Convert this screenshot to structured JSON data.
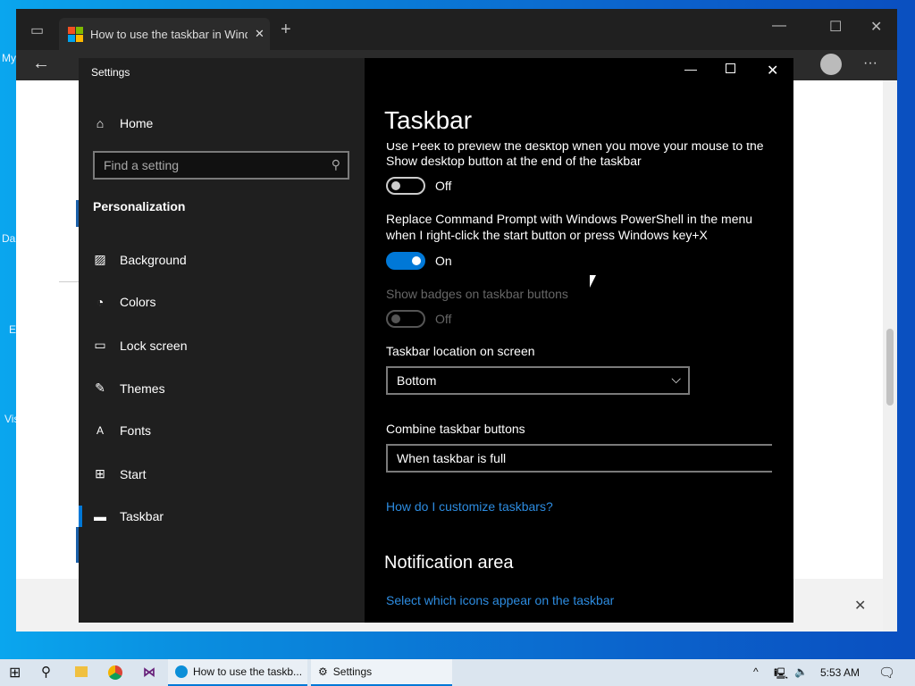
{
  "desktop": {
    "icons": [
      "My",
      "Da",
      "E",
      "Vis"
    ]
  },
  "browser": {
    "tab_title": "How to use the taskbar in Windo",
    "new_tab": "+",
    "more": "···"
  },
  "settings": {
    "window_title": "Settings",
    "nav": {
      "home": "Home",
      "search_placeholder": "Find a setting",
      "section": "Personalization",
      "items": [
        {
          "label": "Background",
          "icon": "picture-icon"
        },
        {
          "label": "Colors",
          "icon": "palette-icon"
        },
        {
          "label": "Lock screen",
          "icon": "lock-screen-icon"
        },
        {
          "label": "Themes",
          "icon": "themes-icon"
        },
        {
          "label": "Fonts",
          "icon": "fonts-icon"
        },
        {
          "label": "Start",
          "icon": "start-icon"
        },
        {
          "label": "Taskbar",
          "icon": "taskbar-icon",
          "selected": true
        }
      ]
    },
    "page_title": "Taskbar",
    "peek": {
      "text1": "Use Peek to preview the desktop when you move your mouse to the",
      "text2": "Show desktop button at the end of the taskbar",
      "state": "Off"
    },
    "powershell": {
      "text1": "Replace Command Prompt with Windows PowerShell in the menu",
      "text2": "when I right-click the start button or press Windows key+X",
      "state": "On"
    },
    "badges": {
      "text": "Show badges on taskbar buttons",
      "state": "Off",
      "disabled": true
    },
    "location": {
      "label": "Taskbar location on screen",
      "value": "Bottom"
    },
    "combine": {
      "label": "Combine taskbar buttons",
      "value": "When taskbar is full"
    },
    "help_link": "How do I customize taskbars?",
    "notification_heading": "Notification area",
    "notification_link": "Select which icons appear on the taskbar",
    "accent": "#0078d7"
  },
  "taskbar": {
    "edge_task": "How to use the taskb...",
    "settings_task": "Settings",
    "time": "5:53 AM"
  }
}
